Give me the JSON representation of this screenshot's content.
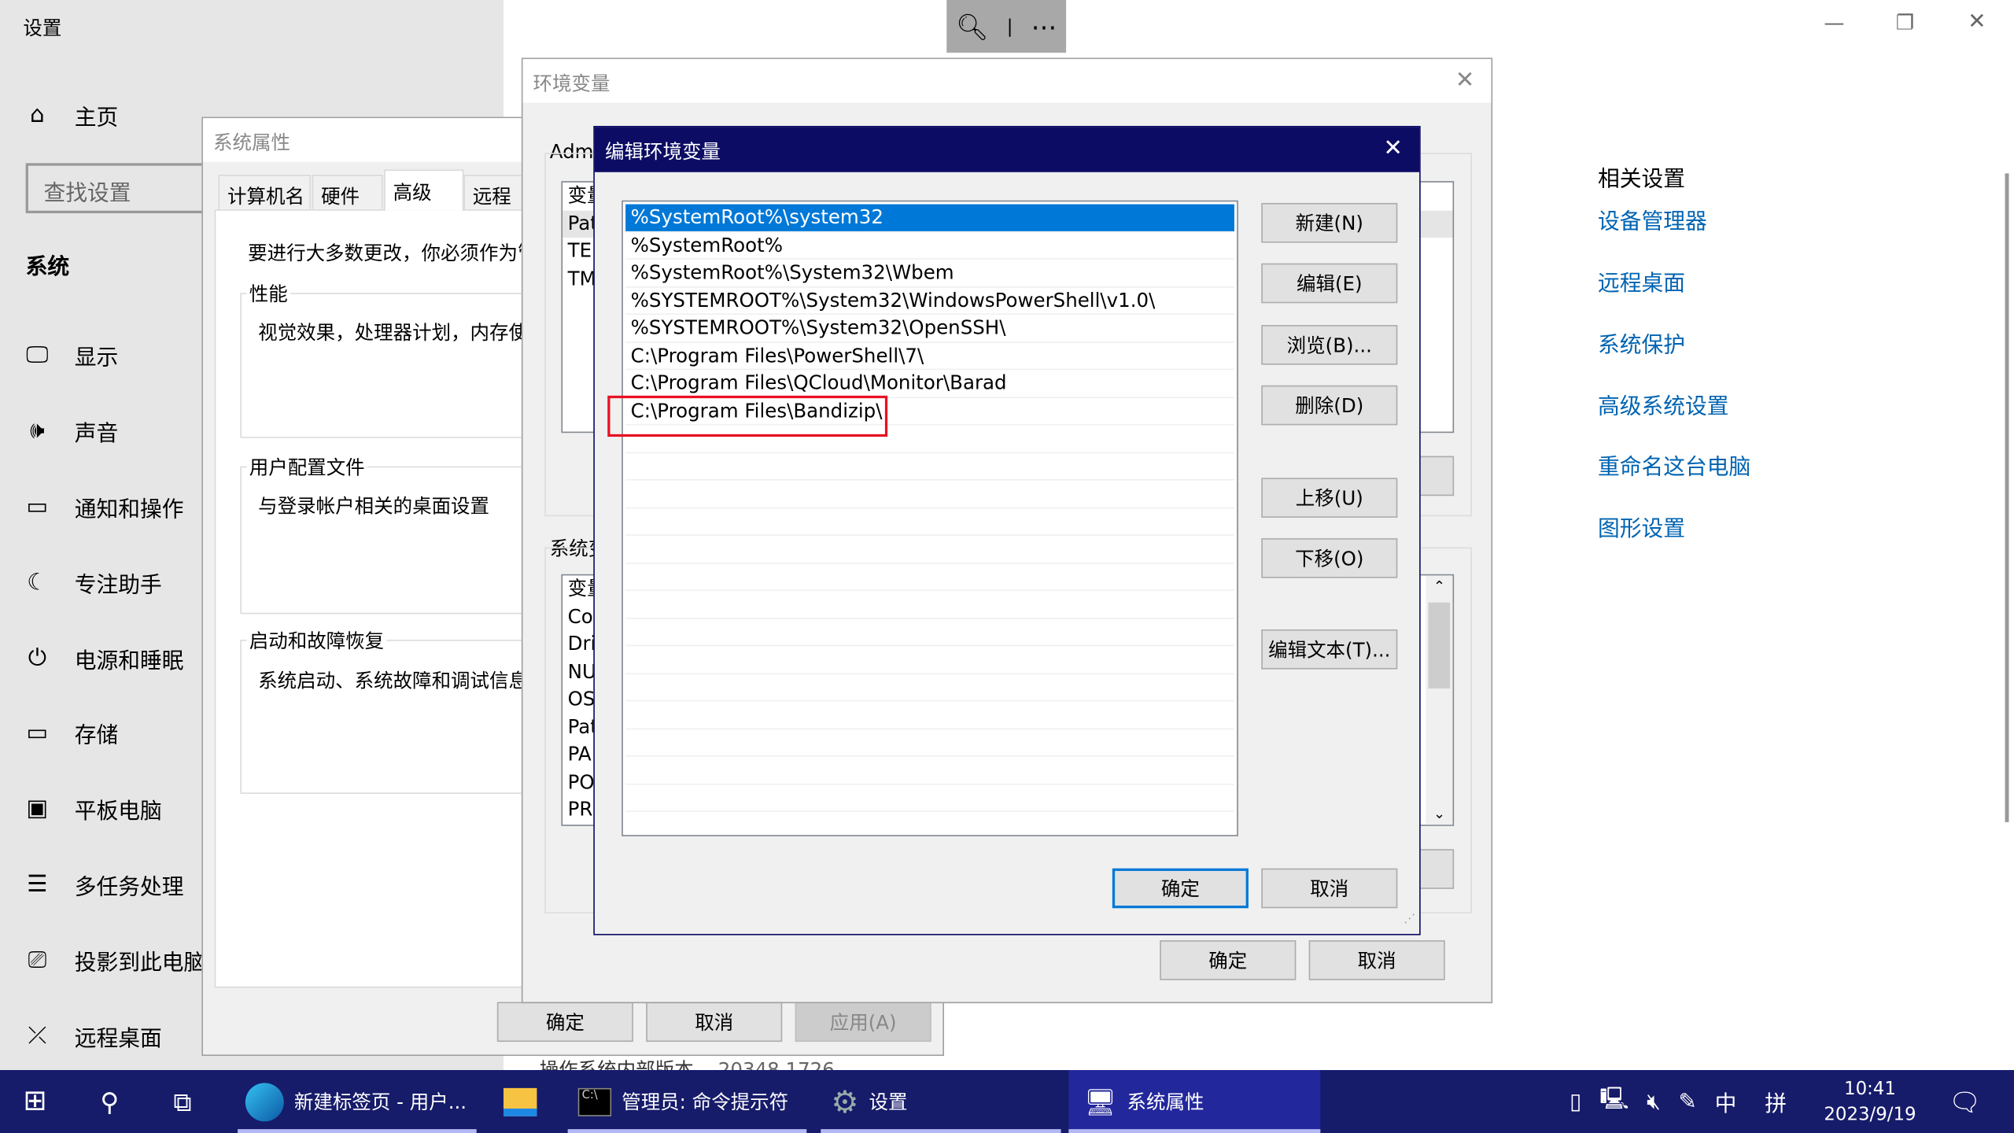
{
  "settings": {
    "title": "设置",
    "home": "主页",
    "search_placeholder": "查找设置",
    "section": "系统",
    "nav": [
      {
        "label": "显示",
        "icon": "monitor-icon"
      },
      {
        "label": "声音",
        "icon": "speaker-icon"
      },
      {
        "label": "通知和操作",
        "icon": "notification-icon"
      },
      {
        "label": "专注助手",
        "icon": "moon-icon"
      },
      {
        "label": "电源和睡眠",
        "icon": "power-icon"
      },
      {
        "label": "存储",
        "icon": "storage-icon"
      },
      {
        "label": "平板电脑",
        "icon": "tablet-icon"
      },
      {
        "label": "多任务处理",
        "icon": "multitask-icon"
      },
      {
        "label": "投影到此电脑",
        "icon": "project-icon"
      },
      {
        "label": "远程桌面",
        "icon": "remote-icon"
      }
    ],
    "related_title": "相关设置",
    "related": [
      "设备管理器",
      "远程桌面",
      "系统保护",
      "高级系统设置",
      "重命名这台电脑",
      "图形设置"
    ],
    "build_label": "操作系统内部版本",
    "build_value": "20348.1726"
  },
  "sysprops": {
    "title": "系统属性",
    "tabs": [
      "计算机名",
      "硬件",
      "高级",
      "远程"
    ],
    "active_tab": "高级",
    "intro": "要进行大多数更改，你必须作为管",
    "perf_label": "性能",
    "perf_text": "视觉效果，处理器计划，内存使",
    "profile_label": "用户配置文件",
    "profile_text": "与登录帐户相关的桌面设置",
    "startup_label": "启动和故障恢复",
    "startup_text": "系统启动、系统故障和调试信息",
    "ok": "确定",
    "cancel": "取消",
    "apply": "应用(A)"
  },
  "envvars": {
    "title": "环境变量",
    "user_label": "Adm",
    "user_rows": [
      "变量",
      "Pat",
      "TEM",
      "TM"
    ],
    "system_label": "系统变",
    "system_rows": [
      "变量",
      "Co",
      "Dri",
      "NU",
      "OS",
      "Pat",
      "PA",
      "PO",
      "PR"
    ],
    "ok": "确定",
    "cancel": "取消"
  },
  "editenv": {
    "title": "编辑环境变量",
    "entries": [
      "%SystemRoot%\\system32",
      "%SystemRoot%",
      "%SystemRoot%\\System32\\Wbem",
      "%SYSTEMROOT%\\System32\\WindowsPowerShell\\v1.0\\",
      "%SYSTEMROOT%\\System32\\OpenSSH\\",
      "C:\\Program Files\\PowerShell\\7\\",
      "C:\\Program Files\\QCloud\\Monitor\\Barad",
      "C:\\Program Files\\Bandizip\\"
    ],
    "selected_index": 0,
    "highlighted_entry": "C:\\Program Files\\Bandizip\\",
    "buttons": {
      "new": "新建(N)",
      "edit": "编辑(E)",
      "browse": "浏览(B)...",
      "delete": "删除(D)",
      "up": "上移(U)",
      "down": "下移(O)",
      "edit_text": "编辑文本(T)..."
    },
    "ok": "确定",
    "cancel": "取消"
  },
  "taskbar": {
    "items": [
      {
        "label": "新建标签页 - 用户...",
        "icon": "edge-icon"
      },
      {
        "label": "",
        "icon": "file-explorer-icon"
      },
      {
        "label": "管理员: 命令提示符",
        "icon": "cmd-icon"
      },
      {
        "label": "设置",
        "icon": "settings-gear-icon"
      },
      {
        "label": "系统属性",
        "icon": "system-properties-icon"
      }
    ],
    "ime_lang": "中",
    "ime_mode": "拼",
    "time": "10:41",
    "date": "2023/9/19"
  },
  "colors": {
    "titlebar_active": "#0c0c64",
    "selection": "#0078d7",
    "link": "#0063b1",
    "taskbar": "#161b6a",
    "highlight_box": "#e81123"
  }
}
